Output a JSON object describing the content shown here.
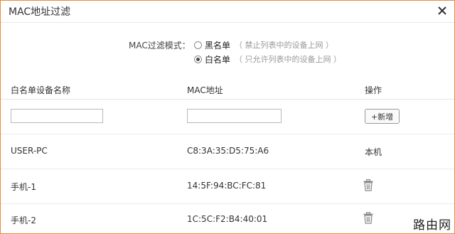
{
  "dialog": {
    "title": "MAC地址过滤",
    "close_icon": "close-icon"
  },
  "mode": {
    "label": "MAC过滤模式：",
    "options": [
      {
        "label": "黑名单",
        "hint": "（ 禁止列表中的设备上网 ）",
        "selected": false
      },
      {
        "label": "白名单",
        "hint": "（ 只允许列表中的设备上网 ）",
        "selected": true
      }
    ]
  },
  "table": {
    "headers": {
      "name": "白名单设备名称",
      "mac": "MAC地址",
      "action": "操作"
    },
    "new_row": {
      "name_value": "",
      "mac_value": "",
      "add_label": "+新增"
    },
    "rows": [
      {
        "name": "USER-PC",
        "mac": "C8:3A:35:D5:75:A6",
        "action": "本机"
      },
      {
        "name": "手机-1",
        "mac": "14:5F:94:BC:FC:81",
        "action_icon": "trash-icon"
      },
      {
        "name": "手机-2",
        "mac": "1C:5C:F2:B4:40:01",
        "action_icon": "trash-icon"
      }
    ]
  },
  "watermark": "路由网",
  "colors": {
    "border_accent": "#e98a3b",
    "divider": "#e6e6e6",
    "text": "#333333",
    "hint": "#999999"
  }
}
